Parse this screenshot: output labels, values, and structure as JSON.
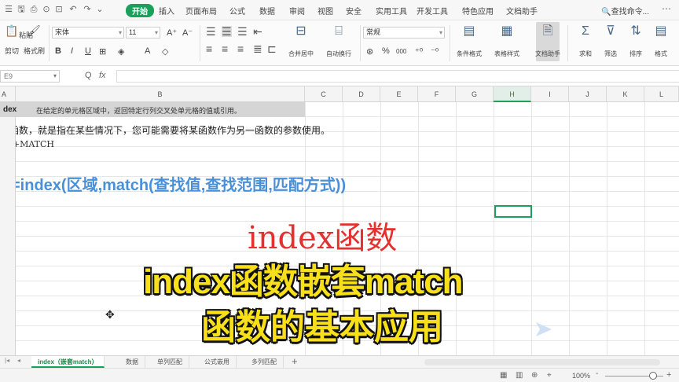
{
  "menubar": {
    "quick_access": [
      "☰",
      "🖫",
      "⎙",
      "⊙",
      "⊡",
      "↶",
      "↷",
      "⌄"
    ],
    "tabs": [
      "开始",
      "插入",
      "页面布局",
      "公式",
      "数据",
      "审阅",
      "视图",
      "安全",
      "实用工具",
      "开发工具",
      "特色应用",
      "文档助手"
    ],
    "active_tab": "开始",
    "search_label": "查找命令..."
  },
  "ribbon": {
    "clipboard": {
      "paste": "粘贴",
      "cut": "剪切",
      "format_painter": "格式刷"
    },
    "font": {
      "name": "宋体",
      "size": "11",
      "bold": "B",
      "italic": "I",
      "underline": "U"
    },
    "alignment": {
      "merge": "合并居中",
      "wrap": "自动换行"
    },
    "number": {
      "format": "常规",
      "percent": "%",
      "comma": "000"
    },
    "styles": {
      "conditional": "条件格式",
      "table_style": "表格样式"
    },
    "doc_assistant": "文档助手",
    "editing": {
      "sum": "求和",
      "filter": "筛选",
      "sort": "排序",
      "format": "格式"
    }
  },
  "formula_bar": {
    "name_box": "E9",
    "fx": "fx",
    "zoom_icon": "Q"
  },
  "columns": [
    "A",
    "B",
    "C",
    "D",
    "E",
    "F",
    "G",
    "H",
    "I",
    "J",
    "K",
    "L"
  ],
  "selected_column": "H",
  "cells": {
    "a1": "dex",
    "b1": "在给定的单元格区域中，返回特定行列交叉处单元格的值或引用。",
    "row2": "套函数，就是指在某些情况下，您可能需要将某函数作为另一函数的参数使用。",
    "row3": "EX+MATCH",
    "formula": "=index(区域,match(查找值,查找范围,匹配方式))"
  },
  "overlay": {
    "red_title": "index函数",
    "caption_line1": "index函数嵌套match",
    "caption_line2": "函数的基本应用"
  },
  "sheet_tabs": [
    "index（嵌套match）",
    "数据",
    "单列匹配",
    "公式嵌用",
    "多列匹配"
  ],
  "active_sheet": "index（嵌套match）",
  "status": {
    "zoom": "100%",
    "minus": "-",
    "plus": "+"
  },
  "colors": {
    "accent": "#1aa05a",
    "formula_blue": "#4a90d9",
    "title_red": "#e53030",
    "caption_yellow": "#f7e01a"
  }
}
